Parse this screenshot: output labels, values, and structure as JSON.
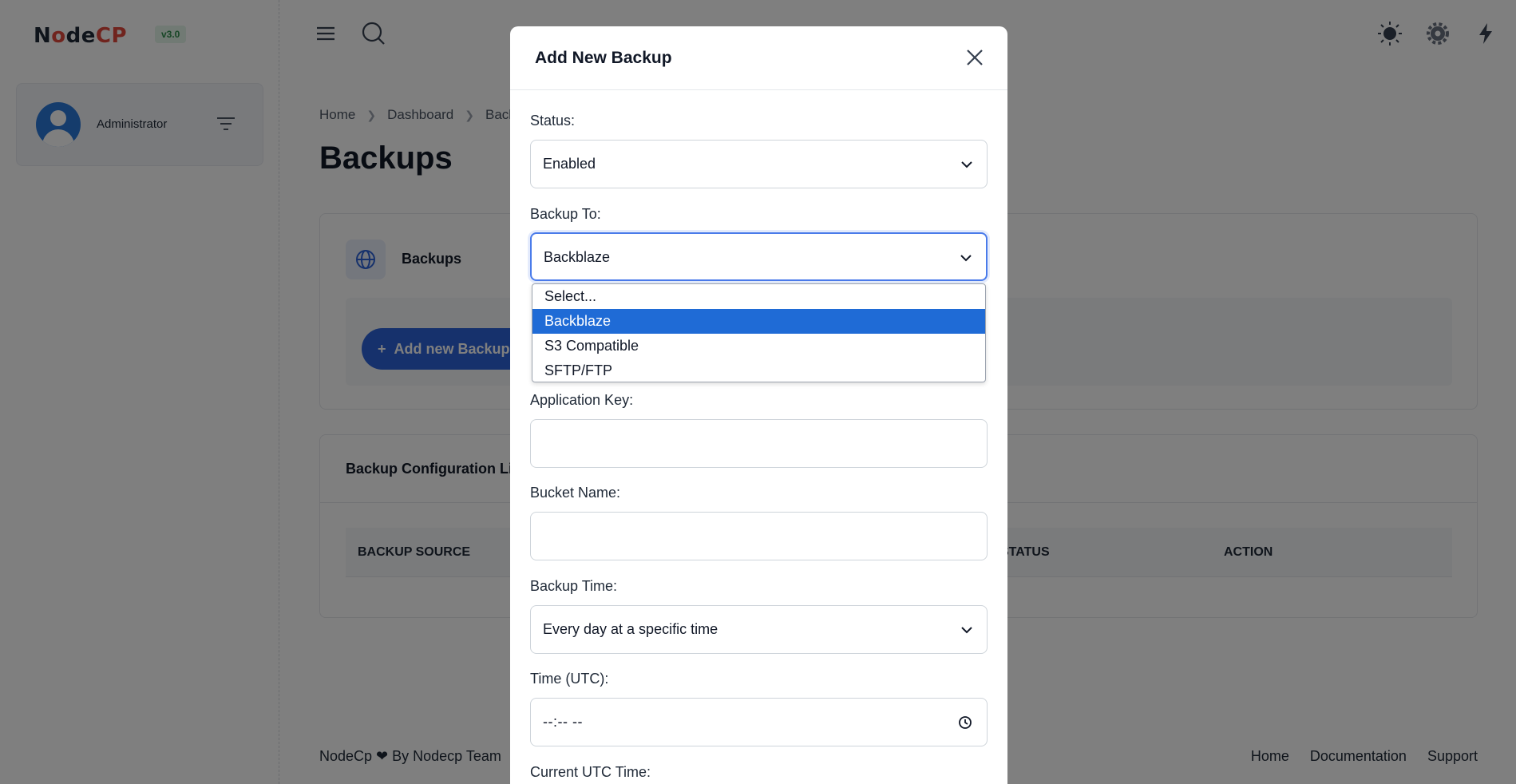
{
  "app": {
    "logo_part1": "N",
    "logo_part2": "o",
    "logo_part3": "de",
    "logo_part4": "CP",
    "version": "v3.0"
  },
  "sidebar": {
    "user_name": "Administrator"
  },
  "breadcrumb": [
    "Home",
    "Dashboard",
    "Backups"
  ],
  "page": {
    "title": "Backups"
  },
  "backups_card": {
    "title": "Backups",
    "add_button_label": "Add new Backup"
  },
  "config_card": {
    "title": "Backup Configuration List",
    "columns": [
      "BACKUP SOURCE",
      "STATUS",
      "ACTION"
    ]
  },
  "footer": {
    "credit": "NodeCp ❤ By Nodecp Team",
    "links": [
      "Home",
      "Documentation",
      "Support"
    ]
  },
  "modal": {
    "title": "Add New Backup",
    "status": {
      "label": "Status:",
      "value": "Enabled"
    },
    "backup_to": {
      "label": "Backup To:",
      "value": "Backblaze",
      "options": [
        "Select...",
        "Backblaze",
        "S3 Compatible",
        "SFTP/FTP"
      ],
      "selected_option": "Backblaze"
    },
    "application_key": {
      "label": "Application Key:",
      "value": ""
    },
    "bucket_name": {
      "label": "Bucket Name:",
      "value": ""
    },
    "backup_time": {
      "label": "Backup Time:",
      "value": "Every day at a specific time"
    },
    "time_utc": {
      "label": "Time (UTC):",
      "value": "--:-- --"
    },
    "current_utc": {
      "label": "Current UTC Time:"
    }
  },
  "colors": {
    "primary": "#2d63d8",
    "logo_red": "#e0483c",
    "dropdown_selected": "#1f6bd6",
    "version_badge_bg": "#e3f5e8",
    "version_badge_text": "#2f8d4c"
  },
  "icons": [
    "hamburger-menu-icon",
    "search-icon",
    "theme-toggle-icon",
    "settings-gear-icon",
    "lightning-icon",
    "filter-icon",
    "globe-icon",
    "plus-icon",
    "close-icon",
    "chevron-down-icon",
    "clock-icon",
    "heart-icon",
    "avatar-icon"
  ]
}
